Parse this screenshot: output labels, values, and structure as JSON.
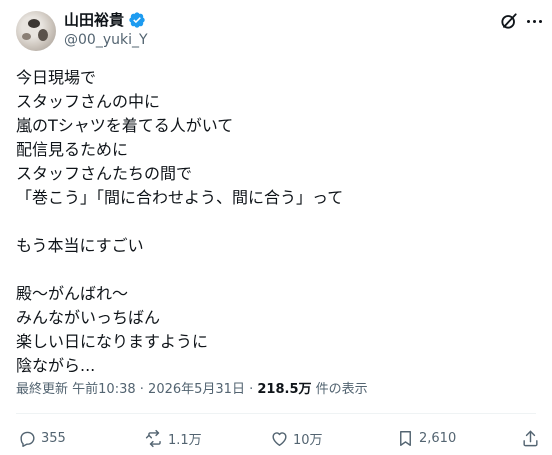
{
  "author": {
    "display_name": "山田裕貴",
    "handle": "@00_yuki_Y",
    "verified_icon": "verified-badge-icon",
    "accent_color": "#1d9bf0"
  },
  "header_icons": [
    "grok-icon",
    "more-icon"
  ],
  "tweet": {
    "lines": [
      "今日現場で",
      "スタッフさんの中に",
      "嵐のTシャツを着てる人がいて",
      "配信見るために",
      "スタッフさんたちの間で",
      "「巻こう」「間に合わせよう、間に合う」って",
      "",
      "もう本当にすごい",
      "",
      "殿〜がんばれ〜",
      "みんながいっちばん",
      "楽しい日になりますように",
      "陰ながら..."
    ]
  },
  "meta": {
    "updated_label": "最終更新",
    "time": "午前10:38",
    "separator": "·",
    "date": "2026年5月31日",
    "views_count": "218.5万",
    "views_label": "件の表示"
  },
  "actions": {
    "replies": "355",
    "reposts": "1.1万",
    "likes": "10万",
    "bookmarks": "2,610"
  }
}
